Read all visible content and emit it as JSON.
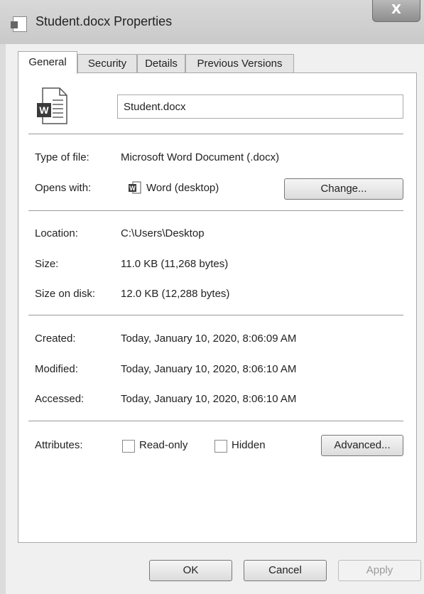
{
  "window": {
    "title": "Student.docx Properties",
    "close_glyph": "X"
  },
  "tabs": [
    {
      "label": "General",
      "active": true
    },
    {
      "label": "Security",
      "active": false
    },
    {
      "label": "Details",
      "active": false
    },
    {
      "label": "Previous Versions",
      "active": false
    }
  ],
  "general": {
    "file_name": "Student.docx",
    "icon": "word-document-icon",
    "rows": {
      "type_label": "Type of file:",
      "type_value": "Microsoft Word Document (.docx)",
      "opens_label": "Opens with:",
      "opens_value": "Word (desktop)",
      "change_button": "Change...",
      "location_label": "Location:",
      "location_value": "C:\\Users\\Desktop",
      "size_label": "Size:",
      "size_value": "11.0 KB (11,268 bytes)",
      "size_disk_label": "Size on disk:",
      "size_disk_value": "12.0 KB (12,288 bytes)",
      "created_label": "Created:",
      "created_value": "Today, January 10, 2020, 8:06:09 AM",
      "modified_label": "Modified:",
      "modified_value": "Today, January 10, 2020, 8:06:10 AM",
      "accessed_label": "Accessed:",
      "accessed_value": "Today, January 10, 2020, 8:06:10 AM",
      "attributes_label": "Attributes:",
      "readonly_label": "Read-only",
      "readonly_checked": false,
      "hidden_label": "Hidden",
      "hidden_checked": false,
      "advanced_button": "Advanced..."
    }
  },
  "footer": {
    "ok": "OK",
    "cancel": "Cancel",
    "apply": "Apply",
    "apply_enabled": false
  }
}
